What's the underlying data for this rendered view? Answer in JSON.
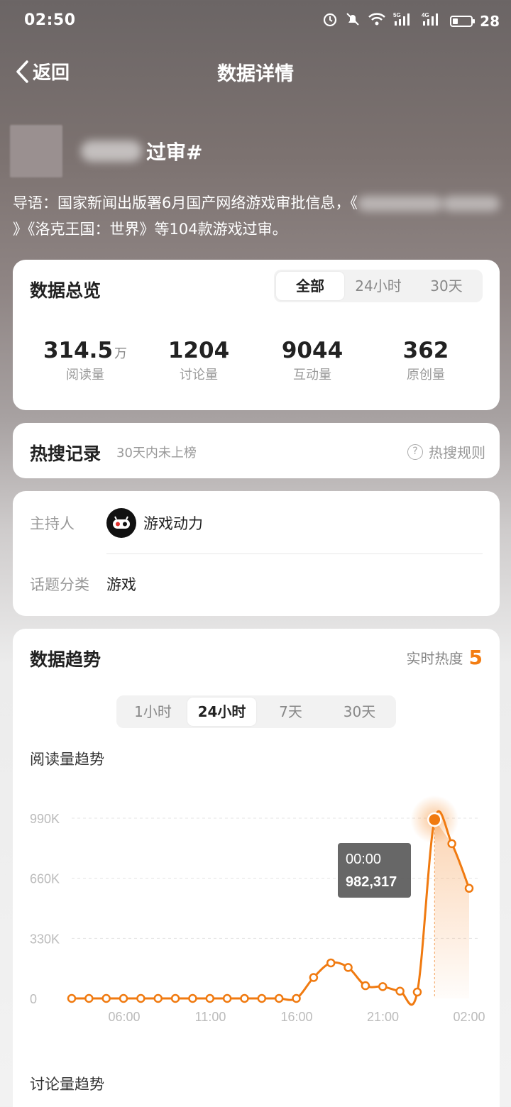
{
  "status": {
    "time": "02:50",
    "battery": "28",
    "battery_level": 0.28,
    "net1": "5G",
    "net2": "4G"
  },
  "nav": {
    "back_label": "返回",
    "title": "数据详情"
  },
  "topic": {
    "title_visible": "过审#",
    "intro_prefix": "导语：国家新闻出版署6月国产网络游戏审批信息，《",
    "intro_suffix": "》《洛克王国：世界》等104款游戏过审。"
  },
  "overview": {
    "title": "数据总览",
    "tabs": [
      "全部",
      "24小时",
      "30天"
    ],
    "active_tab": 0,
    "stats": [
      {
        "value": "314.5",
        "unit": "万",
        "label": "阅读量"
      },
      {
        "value": "1204",
        "unit": "",
        "label": "讨论量"
      },
      {
        "value": "9044",
        "unit": "",
        "label": "互动量"
      },
      {
        "value": "362",
        "unit": "",
        "label": "原创量"
      }
    ]
  },
  "hot_search": {
    "title": "热搜记录",
    "subtitle": "30天内未上榜",
    "rule_label": "热搜规则",
    "rule_icon": "question-circle-icon"
  },
  "info": {
    "host_label": "主持人",
    "host_name": "游戏动力",
    "host_icon": "gamepad-icon",
    "category_label": "话题分类",
    "category_value": "游戏"
  },
  "trend": {
    "title": "数据趋势",
    "heat_label": "实时热度",
    "heat_value": "5",
    "tabs": [
      "1小时",
      "24小时",
      "7天",
      "30天"
    ],
    "active_tab": 1,
    "read_trend_title": "阅读量趋势",
    "discuss_trend_title": "讨论量趋势"
  },
  "colors": {
    "accent": "#f37d12",
    "line": "#f07a10"
  },
  "chart_data": {
    "type": "line",
    "title": "阅读量趋势",
    "y_ticks": [
      "0",
      "330K",
      "660K",
      "990K"
    ],
    "ylim": [
      0,
      990000
    ],
    "x_ticks": [
      "06:00",
      "11:00",
      "16:00",
      "21:00",
      "02:00"
    ],
    "grid": true,
    "series": [
      {
        "values": [
          0,
          0,
          0,
          0,
          0,
          0,
          0,
          0,
          0,
          0,
          0,
          0,
          0,
          0,
          115000,
          195000,
          170000,
          70000,
          65000,
          40000,
          35000,
          982317,
          850000,
          605000
        ]
      }
    ],
    "tooltip": {
      "time": "00:00",
      "value": "982,317",
      "index": 21
    }
  }
}
